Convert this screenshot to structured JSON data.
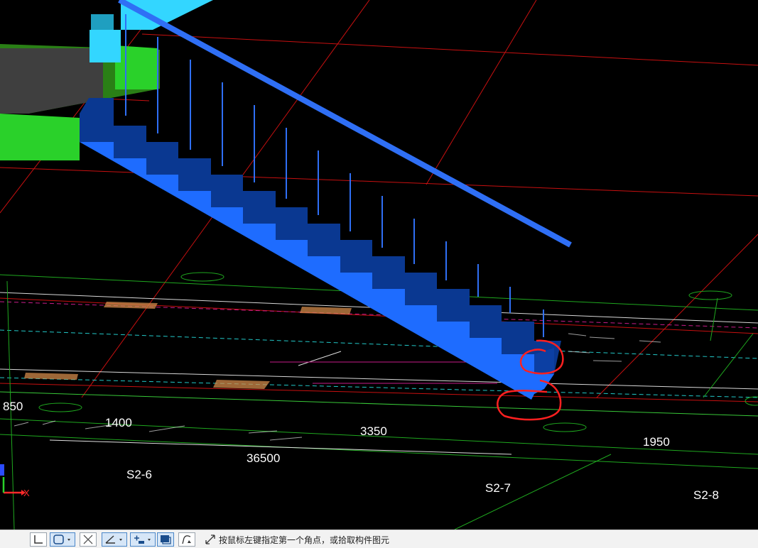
{
  "scene": {
    "dimension_labels": [
      "850",
      "1400",
      "3350",
      "1950",
      "36500"
    ],
    "axis_labels": [
      "S2-6",
      "S2-7",
      "S2-8"
    ],
    "colors": {
      "background": "#000000",
      "stair_side": "#1e6cff",
      "stair_step": "#0a3891",
      "railing": "#2f6ff5",
      "slab_green": "#2ad12a",
      "slab_cyan": "#33d6ff",
      "red_grid": "#d11010",
      "green_dim": "#38c838",
      "red_annotation": "#ff2020"
    }
  },
  "ucs": {
    "x_label": "X"
  },
  "statusbar": {
    "tools": [
      "corner-tool",
      "rectangle-select-tool",
      "cross-select-tool",
      "angle-tool",
      "add-point-tool",
      "component-select-tool",
      "polyline-tool"
    ],
    "hint_icon": "diagonal-arrow-icon",
    "hint_text": "按鼠标左键指定第一个角点，或拾取构件图元"
  }
}
